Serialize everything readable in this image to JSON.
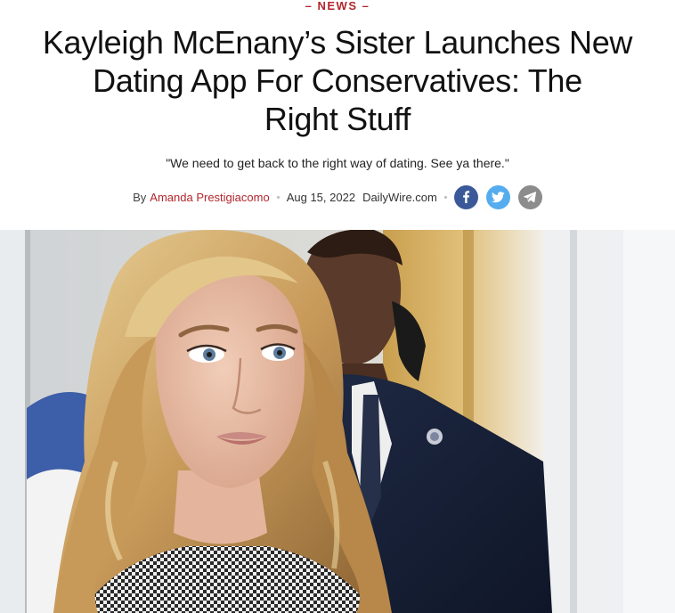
{
  "article": {
    "section": "– NEWS –",
    "headline_lines": [
      "Kayleigh McEnany’s Sister Launches New",
      "Dating App For Conservatives: The",
      "Right Stuff"
    ],
    "subhead": "\"We need to get back to the right way of dating. See ya there.\"",
    "byline": {
      "by": "By",
      "author": "Amanda Prestigiacomo",
      "date": "Aug 15, 2022",
      "source": "DailyWire.com"
    },
    "share_icons": [
      "facebook-icon",
      "twitter-icon",
      "telegram-icon"
    ]
  },
  "colors": {
    "accent": "#b3262d",
    "facebook": "#3b5998",
    "twitter": "#55acee",
    "telegram": "#8c8c8c"
  }
}
